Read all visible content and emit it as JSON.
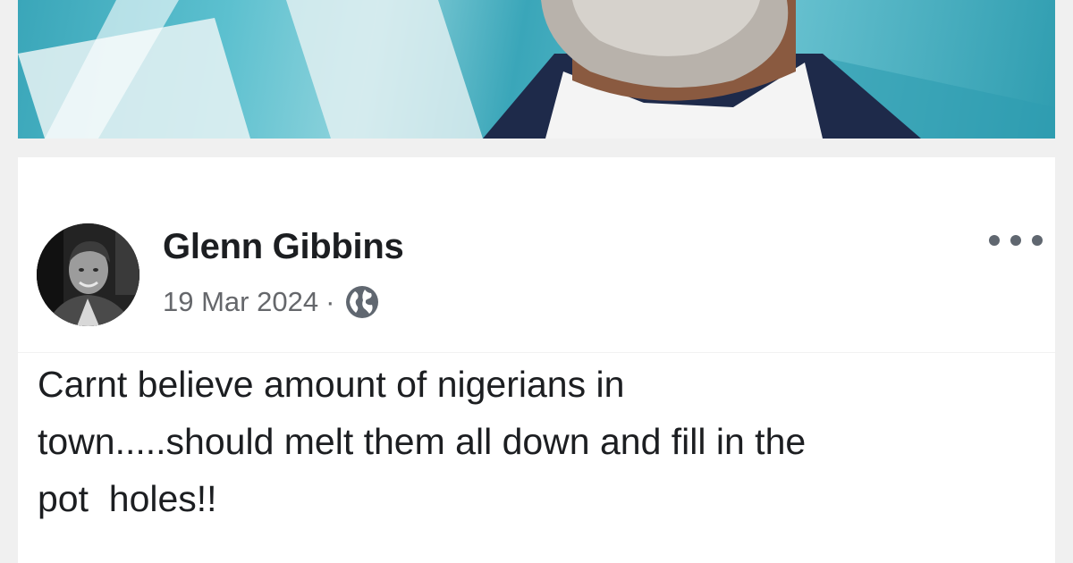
{
  "post": {
    "author_name": "Glenn Gibbins",
    "date": "19 Mar 2024",
    "separator": "·",
    "audience_icon": "globe-icon",
    "more_icon": "more-options-icon",
    "text": "Carnt believe amount of nigerians in\ntown.....should melt them all down and fill in the\npot  holes!!"
  },
  "colors": {
    "card_background": "#ffffff",
    "page_background": "#f0f0f0",
    "author_text": "#1c1e21",
    "meta_text": "#65676b",
    "photo_accent": "#3aa6b9"
  }
}
